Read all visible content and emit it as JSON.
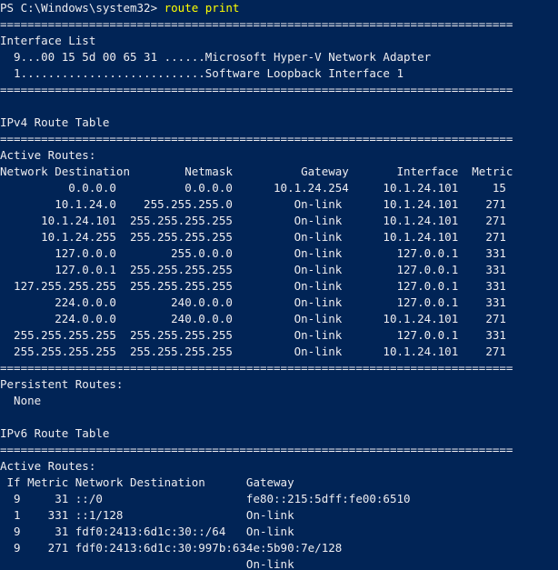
{
  "prompt": {
    "text": "PS C:\\Windows\\system32> ",
    "command": "route print"
  },
  "lines": [
    "===========================================================================",
    "Interface List",
    "  9...00 15 5d 00 65 31 ......Microsoft Hyper-V Network Adapter",
    "  1...........................Software Loopback Interface 1",
    "===========================================================================",
    "",
    "IPv4 Route Table",
    "===========================================================================",
    "Active Routes:",
    "Network Destination        Netmask          Gateway       Interface  Metric",
    "          0.0.0.0          0.0.0.0      10.1.24.254     10.1.24.101     15",
    "        10.1.24.0    255.255.255.0         On-link      10.1.24.101    271",
    "      10.1.24.101  255.255.255.255         On-link      10.1.24.101    271",
    "      10.1.24.255  255.255.255.255         On-link      10.1.24.101    271",
    "        127.0.0.0        255.0.0.0         On-link        127.0.0.1    331",
    "        127.0.0.1  255.255.255.255         On-link        127.0.0.1    331",
    "  127.255.255.255  255.255.255.255         On-link        127.0.0.1    331",
    "        224.0.0.0        240.0.0.0         On-link        127.0.0.1    331",
    "        224.0.0.0        240.0.0.0         On-link      10.1.24.101    271",
    "  255.255.255.255  255.255.255.255         On-link        127.0.0.1    331",
    "  255.255.255.255  255.255.255.255         On-link      10.1.24.101    271",
    "===========================================================================",
    "Persistent Routes:",
    "  None",
    "",
    "IPv6 Route Table",
    "===========================================================================",
    "Active Routes:",
    " If Metric Network Destination      Gateway",
    "  9     31 ::/0                     fe80::215:5dff:fe00:6510",
    "  1    331 ::1/128                  On-link",
    "  9     31 fdf0:2413:6d1c:30::/64   On-link",
    "  9    271 fdf0:2413:6d1c:30:997b:634e:5b90:7e/128",
    "                                    On-link"
  ]
}
